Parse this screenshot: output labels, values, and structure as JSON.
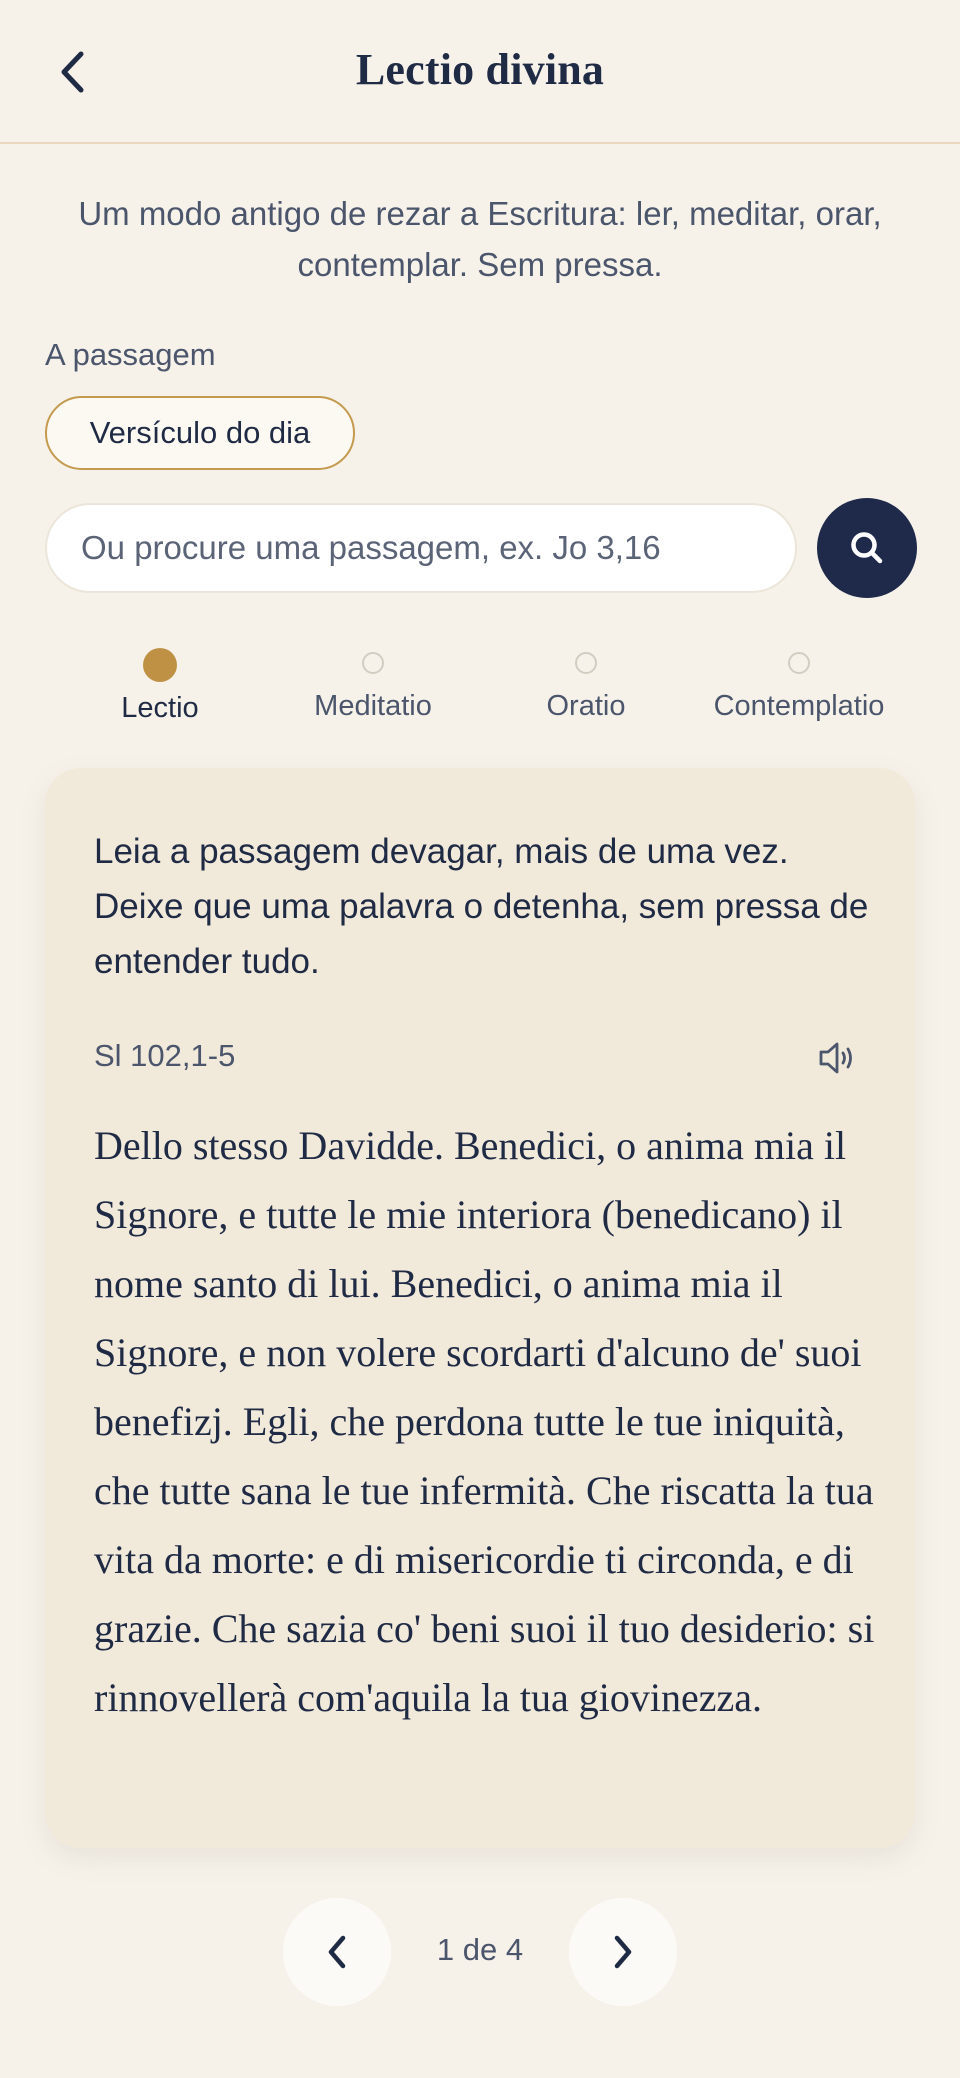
{
  "header": {
    "title": "Lectio divina",
    "back_icon": "chevron-left-icon"
  },
  "intro": "Um modo antigo de rezar a Escritura: ler, meditar, orar, contemplar. Sem pressa.",
  "passage_section": {
    "label": "A passagem",
    "verse_of_day_chip": "Versículo do dia",
    "search_placeholder": "Ou procure uma passagem, ex. Jo 3,16",
    "search_value": "",
    "search_icon": "search-icon"
  },
  "steps": [
    {
      "label": "Lectio",
      "active": true
    },
    {
      "label": "Meditatio",
      "active": false
    },
    {
      "label": "Oratio",
      "active": false
    },
    {
      "label": "Contemplatio",
      "active": false
    }
  ],
  "card": {
    "instruction": "Leia a passagem devagar, mais de uma vez. Deixe que uma palavra o detenha, sem pressa de entender tudo.",
    "reference": "Sl 102,1-5",
    "audio_icon": "speaker-icon",
    "passage": "Dello stesso Davidde. Benedici, o anima mia il Signore, e tutte le mie interiora (benedicano) il nome santo di lui. Benedici, o anima mia il Signore, e non volere scordarti d'alcuno de' suoi benefizj. Egli, che perdona tutte le tue iniquità, che tutte sana le tue infermità. Che riscatta la tua vita da morte: e di misericordie ti circonda, e di grazie. Che sazia co' beni suoi il tuo desiderio: si rinnovellerà com'aquila la tua giovinezza."
  },
  "pager": {
    "text": "1 de 4",
    "prev_icon": "chevron-left-icon",
    "next_icon": "chevron-right-icon"
  },
  "colors": {
    "background": "#f6f2ea",
    "navy": "#1f2a4a",
    "gold": "#bf9145",
    "card": "#f1e9da"
  }
}
